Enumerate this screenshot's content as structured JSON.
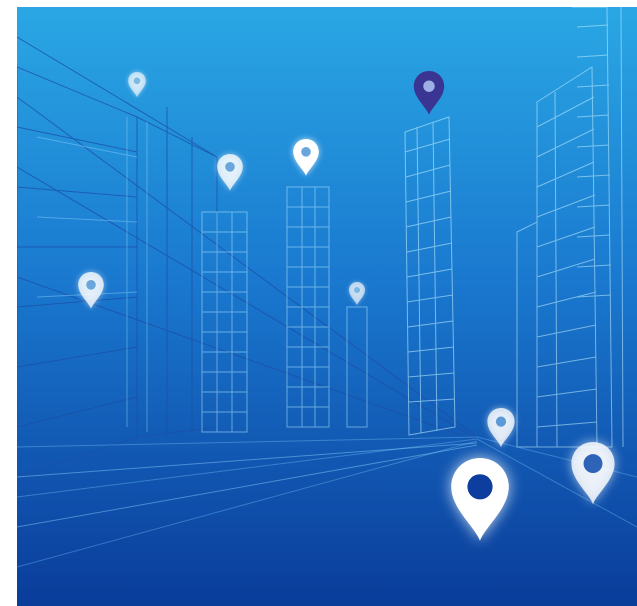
{
  "scene": {
    "subject": "wireframe-city-street",
    "colors": {
      "sky_top": "#2aa7e4",
      "sky_mid": "#1a79cf",
      "sky_bottom": "#0a3c9a",
      "wire": "#9fe0ff",
      "wire_dark": "#1b4fa8",
      "pin_light": "#ffffff",
      "pin_accent": "#3a3592"
    },
    "icons": {
      "pin": "map-pin-icon"
    }
  }
}
